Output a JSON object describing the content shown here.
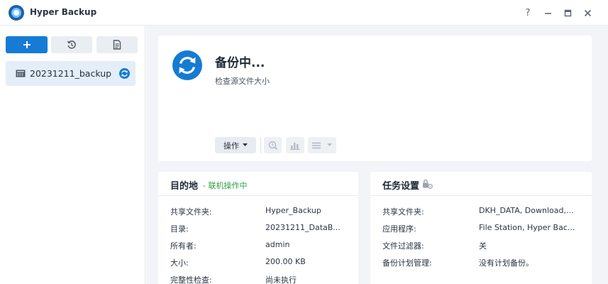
{
  "window": {
    "title": "Hyper Backup",
    "controls": {
      "help": "?",
      "minimize": "—",
      "maximize": "□",
      "close": "✕"
    }
  },
  "sidebar": {
    "toolbar": [
      {
        "icon": "plus-icon"
      },
      {
        "icon": "restore-history-icon"
      },
      {
        "icon": "log-icon"
      }
    ],
    "tasks": [
      {
        "name": "20231211_backup",
        "status_icon": "syncing-icon"
      }
    ]
  },
  "status": {
    "title": "备份中...",
    "subtitle": "检查源文件大小",
    "action_button": "操作",
    "icons": [
      "version-browser-icon",
      "statistics-icon",
      "list-menu-icon"
    ]
  },
  "destination": {
    "title": "目的地",
    "status": "- 联机操作中",
    "rows": [
      {
        "key": "共享文件夹:",
        "value": "Hyper_Backup"
      },
      {
        "key": "目录:",
        "value": "20231211_DataB..."
      },
      {
        "key": "所有者:",
        "value": "admin"
      },
      {
        "key": "大小:",
        "value": "200.00 KB"
      },
      {
        "key": "完整性检查:",
        "value": "尚未执行"
      }
    ]
  },
  "task_settings": {
    "title": "任务设置",
    "rows": [
      {
        "key": "共享文件夹:",
        "value": "DKH_DATA, Download,..."
      },
      {
        "key": "应用程序:",
        "value": "File Station, Hyper Bac..."
      },
      {
        "key": "文件过滤器:",
        "value": "关"
      },
      {
        "key": "备份计划管理:",
        "value": "没有计划备份。"
      }
    ]
  },
  "colors": {
    "accent": "#167bd4",
    "online_status": "#2f9e44",
    "selected_item": "#e3eef9",
    "main_bg": "#f2f4f7"
  }
}
